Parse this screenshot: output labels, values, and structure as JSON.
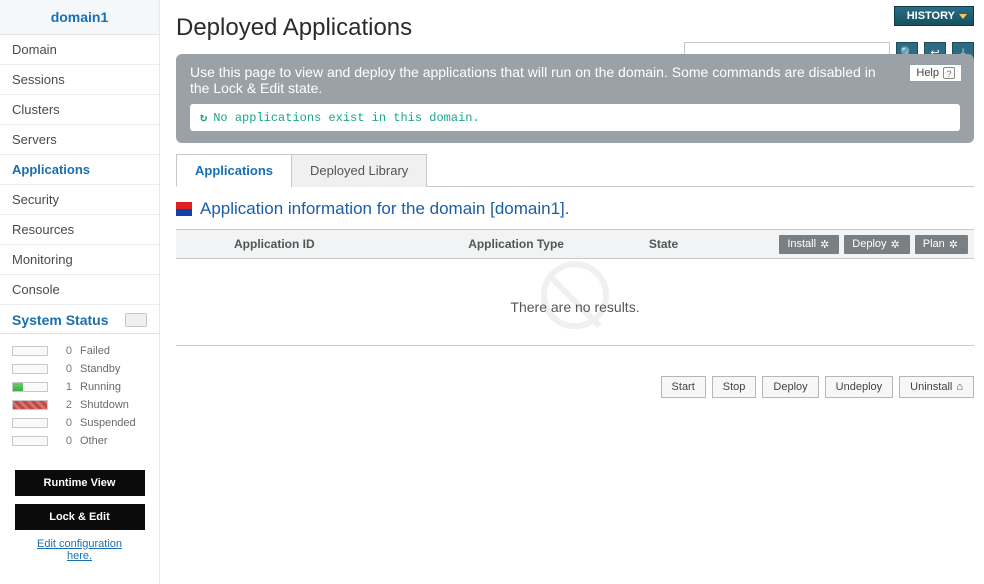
{
  "sidebar": {
    "title": "domain1",
    "items": [
      {
        "label": "Domain"
      },
      {
        "label": "Sessions"
      },
      {
        "label": "Clusters"
      },
      {
        "label": "Servers"
      },
      {
        "label": "Applications",
        "active": true
      },
      {
        "label": "Security"
      },
      {
        "label": "Resources"
      },
      {
        "label": "Monitoring"
      },
      {
        "label": "Console"
      }
    ],
    "system_status_label": "System Status",
    "status": [
      {
        "label": "Failed",
        "count": "0",
        "fill": ""
      },
      {
        "label": "Standby",
        "count": "0",
        "fill": ""
      },
      {
        "label": "Running",
        "count": "1",
        "fill": "green"
      },
      {
        "label": "Shutdown",
        "count": "2",
        "fill": "red"
      },
      {
        "label": "Suspended",
        "count": "0",
        "fill": ""
      },
      {
        "label": "Other",
        "count": "0",
        "fill": ""
      }
    ],
    "runtime_view_btn": "Runtime View",
    "lock_edit_btn": "Lock & Edit",
    "edit_link": "Edit configuration here."
  },
  "header": {
    "history_btn": "HISTORY",
    "page_title": "Deployed Applications",
    "search_placeholder": "",
    "help_label": "Help"
  },
  "banner": {
    "text": "Use this page to view and deploy the applications that will run on the domain. Some commands are disabled in the Lock & Edit state.",
    "note": "No applications exist in this domain."
  },
  "tabs": {
    "tab_applications": "Applications",
    "tab_deployed_library": "Deployed Library"
  },
  "section": {
    "title": "Application information for the domain [domain1]."
  },
  "table": {
    "columns": {
      "app_id": "Application ID",
      "app_type": "Application Type",
      "state": "State"
    },
    "header_actions": {
      "install": "Install",
      "deploy": "Deploy",
      "plan": "Plan"
    },
    "empty": "There are no results."
  },
  "footer_actions": {
    "start": "Start",
    "stop": "Stop",
    "deploy": "Deploy",
    "undeploy": "Undeploy",
    "uninstall": "Uninstall"
  }
}
